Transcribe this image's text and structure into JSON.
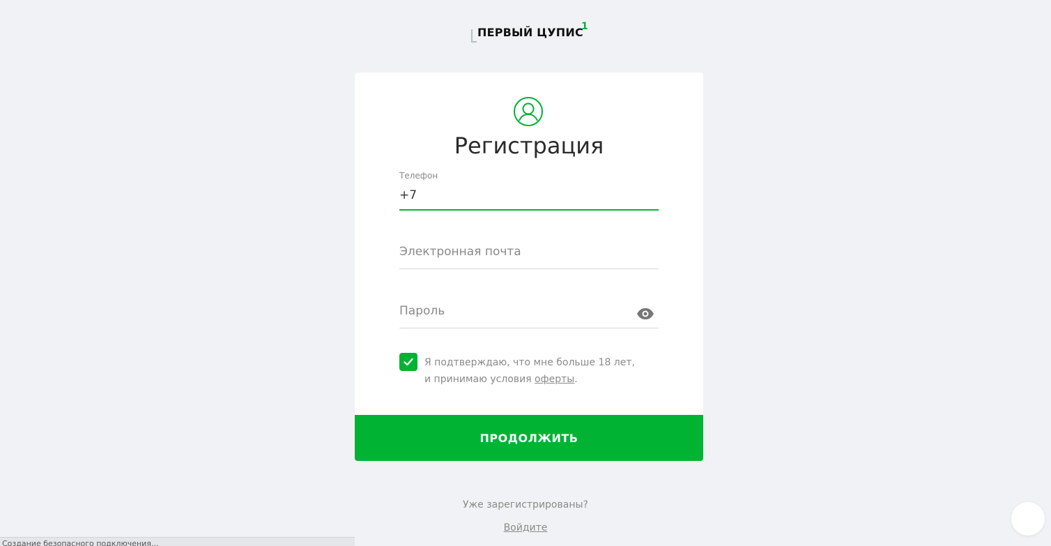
{
  "logo": {
    "text": "ПЕРВЫЙ ЦУПИС",
    "superscript": "1"
  },
  "form": {
    "title": "Регистрация",
    "phone": {
      "label": "Телефон",
      "value": "+7"
    },
    "email": {
      "placeholder": "Электронная почта"
    },
    "password": {
      "placeholder": "Пароль"
    },
    "consent": {
      "checked": true,
      "line1": "Я подтверждаю, что мне больше 18 лет,",
      "line2_prefix": "и принимаю условия",
      "link": "оферты",
      "line2_suffix": "."
    },
    "submit_label": "ПРОДОЛЖИТЬ"
  },
  "footer": {
    "already": "Уже зарегистрированы?",
    "login_link": "Войдите"
  },
  "status_bar": {
    "text": "Создание безопасного подключения..."
  },
  "colors": {
    "accent": "#00b333",
    "background": "#f0f2f5",
    "text_muted": "#8a8a8a"
  },
  "icons": [
    "user-circle-icon",
    "eye-icon",
    "checkmark-icon"
  ]
}
